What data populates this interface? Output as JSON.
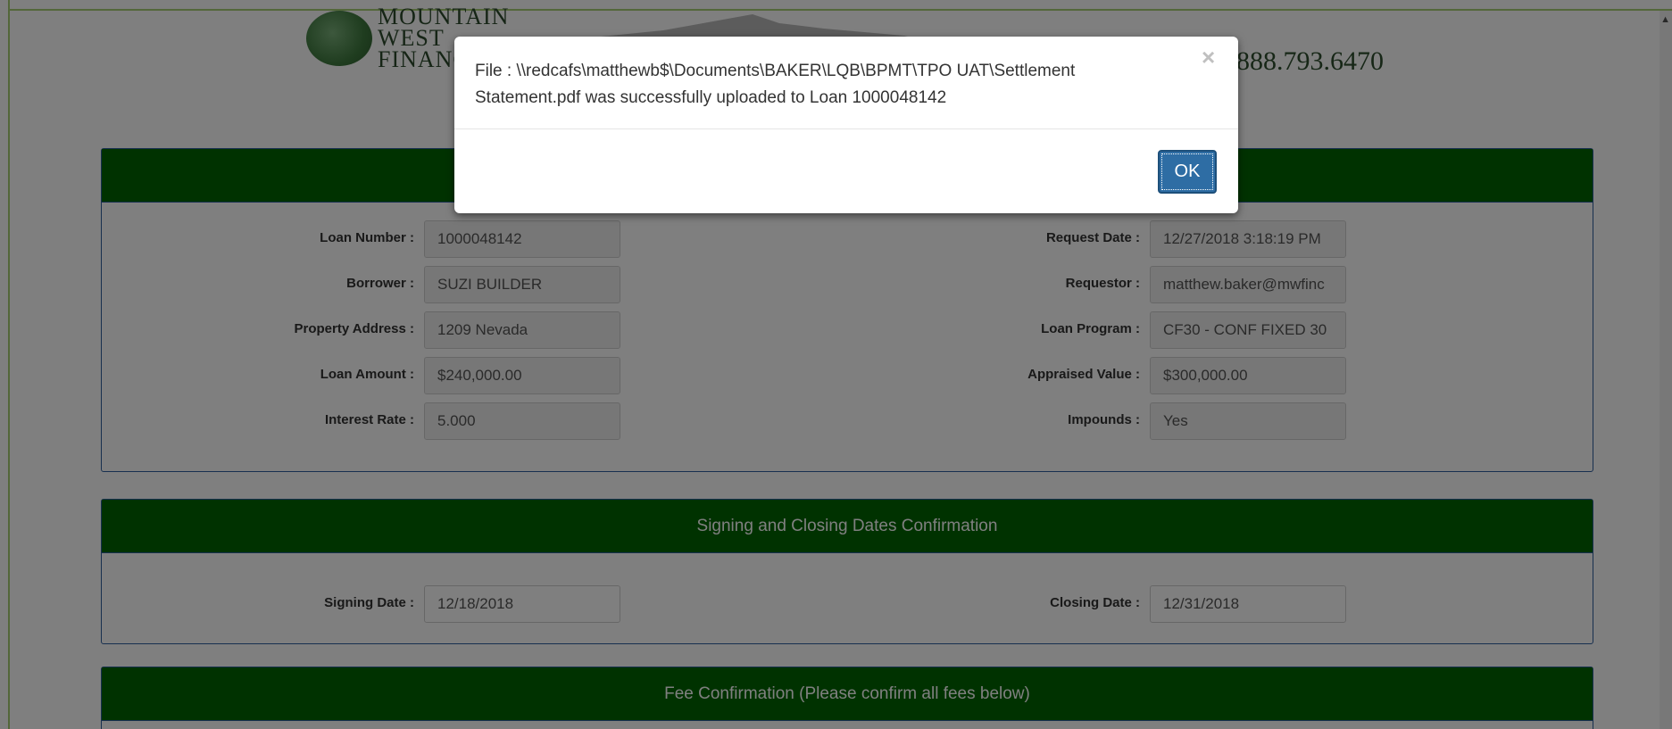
{
  "header": {
    "logo_text": [
      "MOUNTAIN",
      "WEST",
      "FINANCIAL"
    ],
    "phone": "888.793.6470"
  },
  "loan_panel": {
    "rows": [
      {
        "left_label": "Loan Number :",
        "left_value": "1000048142",
        "right_label": "Request Date :",
        "right_value": "12/27/2018 3:18:19 PM"
      },
      {
        "left_label": "Borrower :",
        "left_value": "SUZI BUILDER",
        "right_label": "Requestor :",
        "right_value": "matthew.baker@mwfinc"
      },
      {
        "left_label": "Property Address :",
        "left_value": "1209 Nevada",
        "right_label": "Loan Program :",
        "right_value": "CF30 - CONF FIXED 30"
      },
      {
        "left_label": "Loan Amount :",
        "left_value": "$240,000.00",
        "right_label": "Appraised Value :",
        "right_value": "$300,000.00"
      },
      {
        "left_label": "Interest Rate :",
        "left_value": "5.000",
        "right_label": "Impounds :",
        "right_value": "Yes"
      }
    ]
  },
  "dates_panel": {
    "title": "Signing and Closing Dates Confirmation",
    "signing_label": "Signing Date :",
    "signing_value": "12/18/2018",
    "closing_label": "Closing Date :",
    "closing_value": "12/31/2018"
  },
  "fee_panel": {
    "title": "Fee Confirmation (Please confirm all fees below)"
  },
  "modal": {
    "message": "File : \\\\redcafs\\matthewb$\\Documents\\BAKER\\LQB\\BPMT\\TPO UAT\\Settlement Statement.pdf was successfully uploaded to Loan 1000048142",
    "close_glyph": "×",
    "ok_label": "OK"
  },
  "colors": {
    "panel_header": "#006400",
    "panel_border": "#2f5f9f",
    "ok_button": "#2e6da4",
    "frame_border": "#a7cf74"
  }
}
